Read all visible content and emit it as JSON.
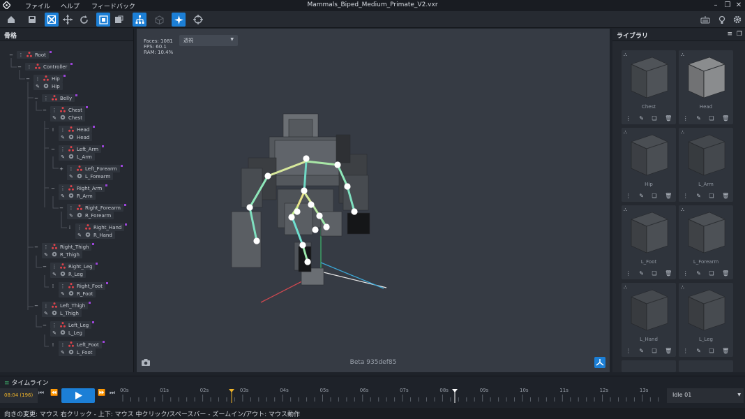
{
  "app": {
    "title": "Mammals_Biped_Medium_Primate_V2.vxr",
    "menu": [
      "ファイル",
      "ヘルプ",
      "フィードバック"
    ]
  },
  "skeleton": {
    "title": "骨格",
    "bones": [
      {
        "bone": "Root",
        "bone_glyph": "−",
        "depth": 0
      },
      {
        "bone": "Controller",
        "bone_glyph": "−",
        "depth": 1
      },
      {
        "bone": "Hip",
        "bone_glyph": "−",
        "mesh": "Hip",
        "depth": 2
      },
      {
        "bone": "Belly",
        "bone_glyph": "−",
        "depth": 3
      },
      {
        "bone": "Chest",
        "bone_glyph": "−",
        "mesh": "Chest",
        "depth": 4
      },
      {
        "bone": "Head",
        "bone_glyph": "⁞",
        "mesh": "Head",
        "depth": 5
      },
      {
        "bone": "Left_Arm",
        "bone_glyph": "−",
        "mesh": "L_Arm",
        "depth": 5
      },
      {
        "bone": "Left_Forearm",
        "bone_glyph": "+",
        "mesh": "L_Forearm",
        "depth": 6
      },
      {
        "bone": "Right_Arm",
        "bone_glyph": "−",
        "mesh": "R_Arm",
        "depth": 5
      },
      {
        "bone": "Right_Forearm",
        "bone_glyph": "−",
        "mesh": "R_Forearm",
        "depth": 6
      },
      {
        "bone": "Right_Hand",
        "bone_glyph": "⁞",
        "mesh": "R_Hand",
        "depth": 7
      },
      {
        "bone": "Right_Thigh",
        "bone_glyph": "−",
        "mesh": "R_Thigh",
        "depth": 3
      },
      {
        "bone": "Right_Leg",
        "bone_glyph": "−",
        "mesh": "R_Leg",
        "depth": 4
      },
      {
        "bone": "Right_Foot",
        "bone_glyph": "⁞",
        "mesh": "R_Foot",
        "depth": 5
      },
      {
        "bone": "Left_Thigh",
        "bone_glyph": "−",
        "mesh": "L_Thigh",
        "depth": 3
      },
      {
        "bone": "Left_Leg",
        "bone_glyph": "−",
        "mesh": "L_Leg",
        "depth": 4
      },
      {
        "bone": "Left_Foot",
        "bone_glyph": "⁞",
        "mesh": "L_Foot",
        "depth": 5
      }
    ]
  },
  "viewport": {
    "stats": [
      "Faces: 1081",
      "FPS: 60.1",
      "RAM: 10.4%"
    ],
    "view_mode": "透視",
    "version": "Beta 935def85"
  },
  "library": {
    "title": "ライブラリ",
    "items": [
      "Chest",
      "Head",
      "Hip",
      "L_Arm",
      "L_Foot",
      "L_Forearm",
      "L_Hand",
      "L_Leg"
    ]
  },
  "timeline": {
    "title": "タイムライン",
    "current_time": "08:04 (196)",
    "ticks": [
      "00s",
      "01s",
      "02s",
      "03s",
      "04s",
      "05s",
      "06s",
      "07s",
      "08s",
      "09s",
      "10s",
      "11s",
      "12s",
      "13s"
    ],
    "animation": "Idle 01"
  },
  "status": {
    "text": "向きの変更: マウス 右クリック - 上下: マウス 中クリック/スペースバー - ズームイン/アウト: マウス動作"
  },
  "colors": {
    "accent": "#1c7fd6",
    "bone_red": "#e0424a",
    "marker": "#f0b429"
  }
}
